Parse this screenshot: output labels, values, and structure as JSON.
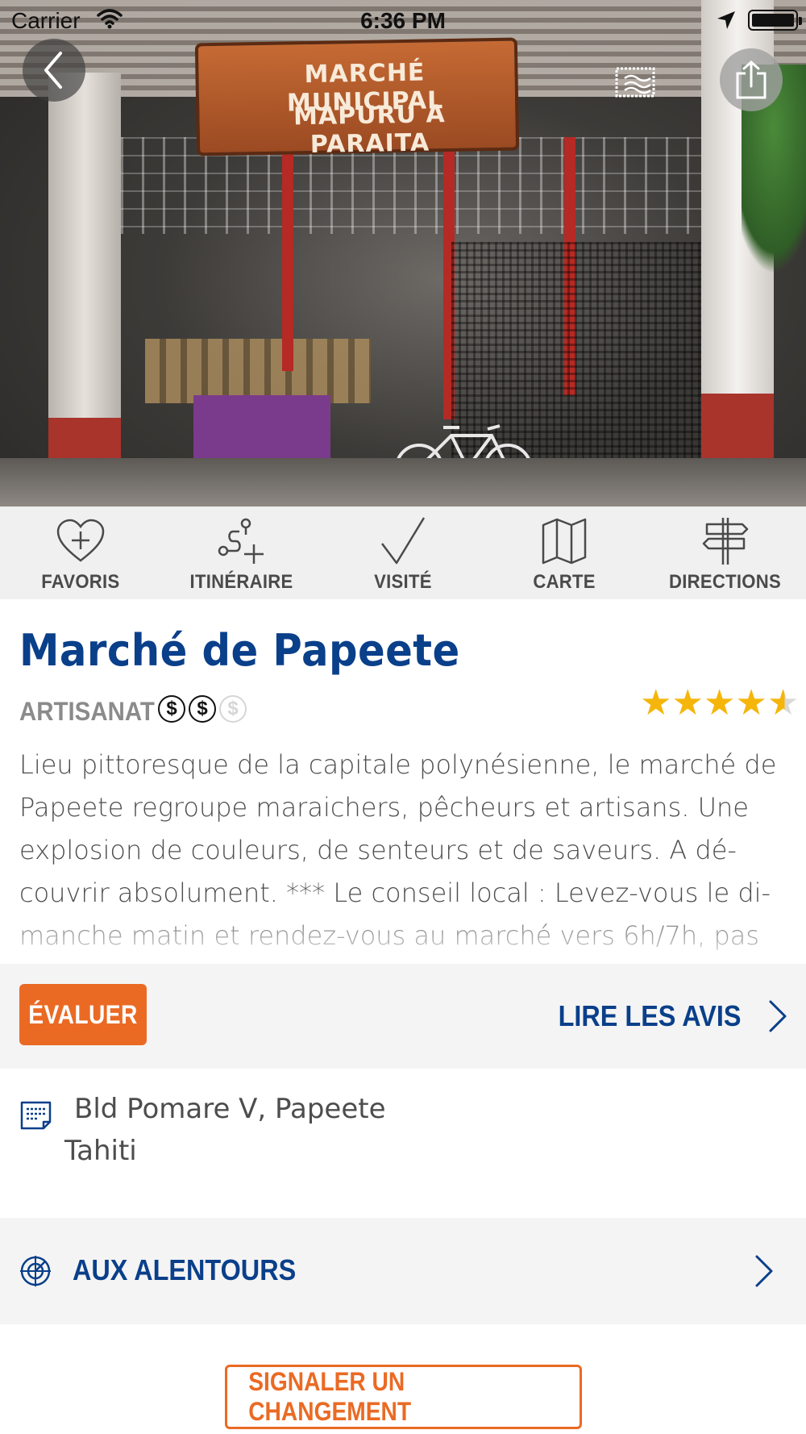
{
  "status_bar": {
    "carrier": "Carrier",
    "time": "6:36 PM"
  },
  "hero": {
    "sign_line1": "MARCHÉ MUNICIPAL",
    "sign_line2": "MAPURU A PARAITA",
    "back_icon": "chevron-left-icon",
    "gallery_icon": "photos-icon",
    "share_icon": "share-icon"
  },
  "actions": [
    {
      "label": "FAVORIS",
      "icon": "heart-plus-icon"
    },
    {
      "label": "ITINÉRAIRE",
      "icon": "route-plus-icon"
    },
    {
      "label": "VISITÉ",
      "icon": "checkmark-icon"
    },
    {
      "label": "CARTE",
      "icon": "map-icon"
    },
    {
      "label": "DIRECTIONS",
      "icon": "signpost-icon"
    }
  ],
  "place": {
    "title": "Marché de Papeete",
    "category": "ARTISANAT",
    "price_symbol": "$",
    "price_level": 2,
    "price_max": 3,
    "rating": 4.5,
    "rating_max": 5,
    "description": "Lieu pittoresque de la capitale polynésienne, le marché de Papeete regroupe maraichers, pêcheurs et artisans. Une explosion de couleurs, de senteurs et de saveurs. A dé-couvrir absolument. *** Le conseil local : Levez-vous le di-manche matin et rendez-vous au marché vers 6h/7h, pas"
  },
  "reviews": {
    "evaluate_label": "ÉVALUER",
    "read_label": "LIRE LES AVIS"
  },
  "address": {
    "line1": "Bld Pomare V, Papeete",
    "line2": "Tahiti"
  },
  "nearby": {
    "label": "AUX ALENTOURS"
  },
  "report": {
    "label": "SIGNALER UN CHANGEMENT"
  },
  "colors": {
    "brand_blue": "#0a3f8a",
    "accent_orange": "#ea6a24",
    "star_gold": "#f5b50a"
  }
}
